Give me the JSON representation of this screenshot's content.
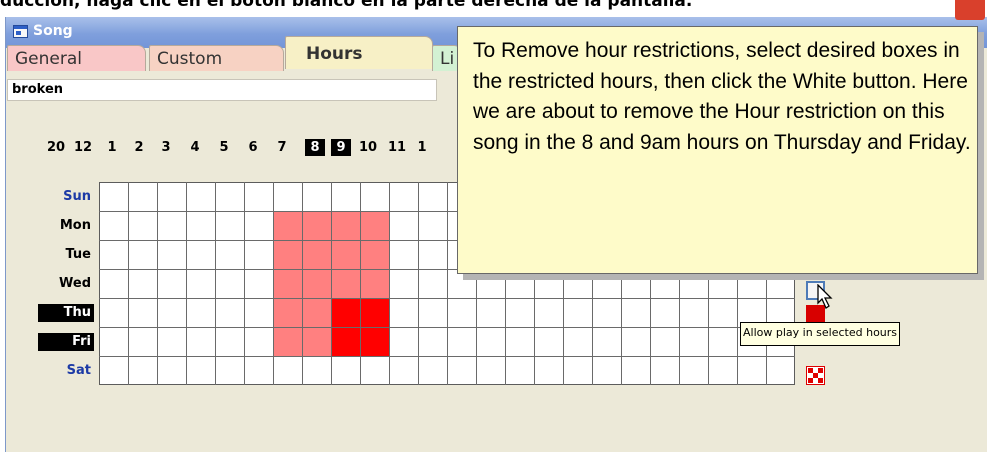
{
  "caption": "ducción, haga clic en el botón blanco en la parte derecha de la pantalla.",
  "window": {
    "title": "Song",
    "tabs": [
      "General",
      "Custom",
      "Hours",
      "Li"
    ],
    "song_name": "broken"
  },
  "hours": {
    "labels": [
      "20",
      "12",
      "1",
      "2",
      "3",
      "4",
      "5",
      "6",
      "7",
      "8",
      "9",
      "10",
      "11",
      "1"
    ],
    "selected": [
      "8",
      "9"
    ],
    "days": [
      "Sun",
      "Mon",
      "Tue",
      "Wed",
      "Thu",
      "Fri",
      "Sat"
    ],
    "selected_days": [
      "Thu",
      "Fri"
    ],
    "weekend_days": [
      "Sun",
      "Sat"
    ],
    "restricted_cells": {
      "Mon": [
        "6",
        "7",
        "8",
        "9"
      ],
      "Tue": [
        "6",
        "7",
        "8",
        "9"
      ],
      "Wed": [
        "6",
        "7",
        "8",
        "9"
      ],
      "Thu": [
        "6",
        "7"
      ],
      "Fri": [
        "6",
        "7"
      ]
    },
    "selected_restricted_cells": {
      "Thu": [
        "8",
        "9"
      ],
      "Fri": [
        "8",
        "9"
      ]
    },
    "grid_columns": 24,
    "grid_rows": 7
  },
  "colors": {
    "restricted": "#ff8080",
    "selected_restricted": "#ff0000",
    "callout_bg": "#fefbc9",
    "tooltip_bg": "#ffffe1"
  },
  "tooltip": "Allow play in selected hours",
  "callout": {
    "text": "To Remove hour restrictions, select desired boxes in the restricted hours, then click the White button.  Here we are about to remove the Hour restriction on this song in the 8 and 9am hours on Thursday and Friday."
  },
  "icons": [
    "allow-play-white-button-icon",
    "restrict-red-button-icon",
    "checker-button-icon",
    "mouse-pointer-icon"
  ]
}
